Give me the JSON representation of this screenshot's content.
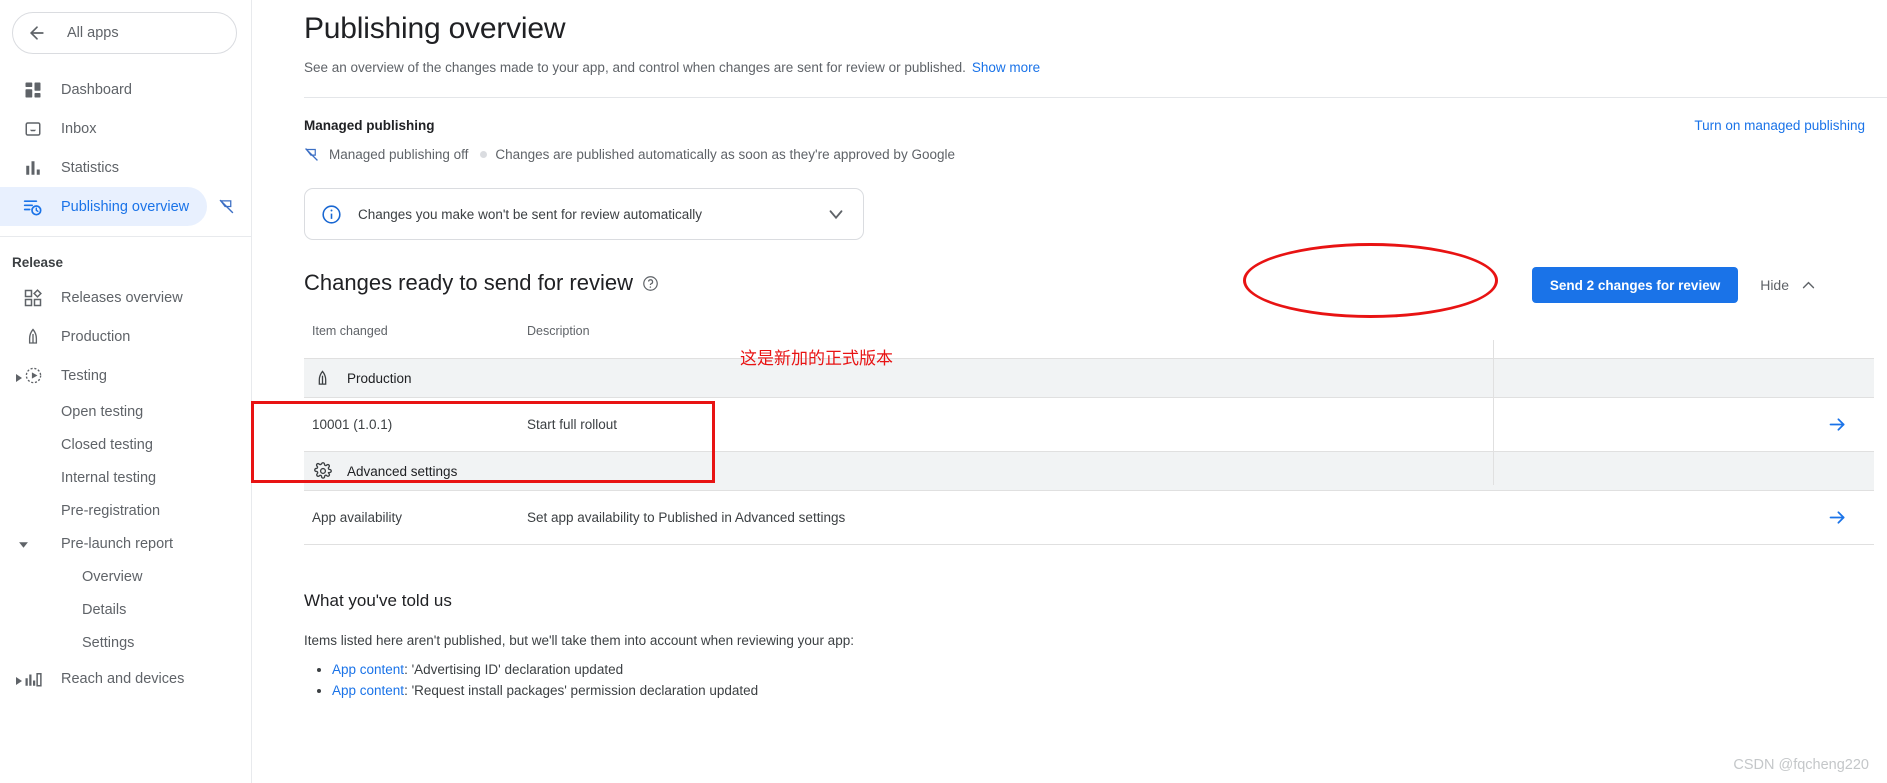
{
  "sidebar": {
    "back_label": "All apps",
    "top_items": [
      {
        "label": "Dashboard",
        "icon": "dashboard-icon"
      },
      {
        "label": "Inbox",
        "icon": "inbox-icon"
      },
      {
        "label": "Statistics",
        "icon": "statistics-icon"
      },
      {
        "label": "Publishing overview",
        "icon": "publishing-overview-icon",
        "active": true,
        "trailing_icon": "managed-publishing-off-icon"
      }
    ],
    "section_label": "Release",
    "release_items": [
      {
        "label": "Releases overview",
        "icon": "releases-overview-icon"
      },
      {
        "label": "Production",
        "icon": "production-icon"
      },
      {
        "label": "Testing",
        "icon": "testing-icon",
        "caret": true
      }
    ],
    "testing_children": [
      {
        "label": "Open testing"
      },
      {
        "label": "Closed testing"
      },
      {
        "label": "Internal testing"
      },
      {
        "label": "Pre-registration"
      }
    ],
    "prelaunch": {
      "label": "Pre-launch report",
      "caret": true
    },
    "prelaunch_children": [
      {
        "label": "Overview"
      },
      {
        "label": "Details"
      },
      {
        "label": "Settings"
      }
    ],
    "reach_item": {
      "label": "Reach and devices",
      "icon": "reach-devices-icon",
      "caret": true
    }
  },
  "page": {
    "title": "Publishing overview",
    "subtitle": "See an overview of the changes made to your app, and control when changes are sent for review or published.",
    "show_more": "Show more"
  },
  "managed_publishing": {
    "title": "Managed publishing",
    "turn_on_link": "Turn on managed publishing",
    "status": "Managed publishing off",
    "status_detail": "Changes are published automatically as soon as they're approved by Google"
  },
  "banner": {
    "text": "Changes you make won't be sent for review automatically",
    "info_icon": "info-icon",
    "chevron_icon": "chevron-down-icon"
  },
  "changes_section": {
    "title": "Changes ready to send for review",
    "help_icon": "help-icon",
    "send_button": "Send 2 changes for review",
    "hide_button": "Hide",
    "hide_chevron": "chevron-up-icon",
    "columns": [
      "Item changed",
      "Description"
    ],
    "groups": [
      {
        "name": "Production",
        "icon": "production-icon",
        "rows": [
          {
            "item": "10001 (1.0.1)",
            "description": "Start full rollout",
            "arrow": "arrow-right-icon"
          }
        ]
      },
      {
        "name": "Advanced settings",
        "icon": "gear-icon",
        "rows": [
          {
            "item": "App availability",
            "description": "Set app availability to Published in Advanced settings",
            "arrow": "arrow-right-icon"
          }
        ]
      }
    ]
  },
  "told_us": {
    "title": "What you've told us",
    "intro": "Items listed here aren't published, but we'll take them into account when reviewing your app:",
    "items": [
      {
        "link": "App content",
        "rest": ": 'Advertising ID' declaration updated"
      },
      {
        "link": "App content",
        "rest": ": 'Request install packages' permission declaration updated"
      }
    ]
  },
  "annotations": {
    "note_text": "这是新加的正式版本",
    "color": "#e81313"
  },
  "watermark": "CSDN @fqcheng220"
}
